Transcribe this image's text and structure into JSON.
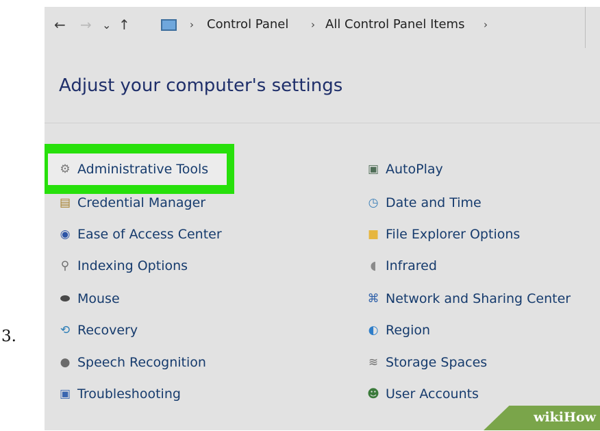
{
  "step_number": "3.",
  "address_bar": {
    "nav_back": "←",
    "nav_forward": "→",
    "nav_history": "⌄",
    "nav_up": "↑",
    "location_icon": "computer-icon",
    "separator": "›",
    "breadcrumbs": [
      "Control Panel",
      "All Control Panel Items"
    ]
  },
  "heading": "Adjust your computer's settings",
  "items_left": [
    {
      "label": "Administrative Tools",
      "icon": "administrative-tools-icon",
      "glyph": "⚙",
      "color": "#7a7a7a",
      "highlighted": true
    },
    {
      "label": "Credential Manager",
      "icon": "credential-manager-icon",
      "glyph": "▤",
      "color": "#a57f2b"
    },
    {
      "label": "Ease of Access Center",
      "icon": "ease-of-access-icon",
      "glyph": "◉",
      "color": "#2d55a6"
    },
    {
      "label": "Indexing Options",
      "icon": "indexing-options-icon",
      "glyph": "⚲",
      "color": "#6f6f6f"
    },
    {
      "label": "Mouse",
      "icon": "mouse-icon",
      "glyph": "⬬",
      "color": "#4a4a4a"
    },
    {
      "label": "Recovery",
      "icon": "recovery-icon",
      "glyph": "⟲",
      "color": "#2f7fb7"
    },
    {
      "label": "Speech Recognition",
      "icon": "microphone-icon",
      "glyph": "●",
      "color": "#6b6b6b"
    },
    {
      "label": "Troubleshooting",
      "icon": "troubleshooting-icon",
      "glyph": "▣",
      "color": "#3a66b0"
    }
  ],
  "items_right": [
    {
      "label": "AutoPlay",
      "icon": "autoplay-icon",
      "glyph": "▣",
      "color": "#4f6e57"
    },
    {
      "label": "Date and Time",
      "icon": "date-time-icon",
      "glyph": "◷",
      "color": "#3b7fb8"
    },
    {
      "label": "File Explorer Options",
      "icon": "folder-icon",
      "glyph": "■",
      "color": "#e6b63f"
    },
    {
      "label": "Infrared",
      "icon": "infrared-icon",
      "glyph": "◖",
      "color": "#8a8a8a"
    },
    {
      "label": "Network and Sharing Center",
      "icon": "network-icon",
      "glyph": "⌘",
      "color": "#2d5fa8"
    },
    {
      "label": "Region",
      "icon": "globe-icon",
      "glyph": "◐",
      "color": "#2f7ec9"
    },
    {
      "label": "Storage Spaces",
      "icon": "storage-spaces-icon",
      "glyph": "≋",
      "color": "#707070"
    },
    {
      "label": "User Accounts",
      "icon": "users-icon",
      "glyph": "☻",
      "color": "#3a7a3a"
    }
  ],
  "watermark": "wikiHow",
  "colors": {
    "highlight": "#27e00b",
    "link": "#163b6d",
    "heading": "#1f2f6a",
    "panel_background": "#e2e2e2"
  }
}
